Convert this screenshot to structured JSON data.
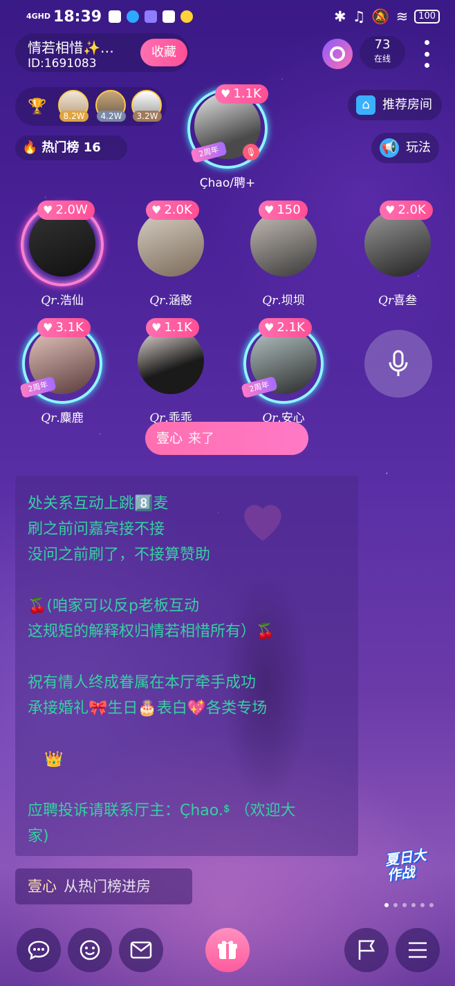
{
  "status_bar": {
    "network": "4GHD",
    "time": "18:39",
    "battery": "100"
  },
  "room": {
    "name": "情若相惜✨…",
    "id": "ID:1691083",
    "favorite_label": "收藏",
    "online_count": "73",
    "online_label": "在线"
  },
  "ranking": {
    "avatars": [
      {
        "value": "8.2W"
      },
      {
        "value": "4.2W"
      },
      {
        "value": "3.2W"
      }
    ],
    "hot_list_label": "热门榜 16"
  },
  "actions": {
    "recommend_label": "推荐房间",
    "play_label": "玩法"
  },
  "host": {
    "name": "Çhao/聘+",
    "hearts": "1.1K",
    "anniversary": "2周年"
  },
  "seats": [
    {
      "prefix": "Qr",
      "name": ".浩仙",
      "hearts": "2.0W"
    },
    {
      "prefix": "Qr",
      "name": ".涵憨",
      "hearts": "2.0K"
    },
    {
      "prefix": "Qr",
      "name": ".坝坝",
      "hearts": "150"
    },
    {
      "prefix": "Qr",
      "name": "喜叁",
      "hearts": "2.0K"
    },
    {
      "prefix": "Qr",
      "name": ".麋鹿",
      "hearts": "3.1K",
      "anniversary": "2周年"
    },
    {
      "prefix": "Qr",
      "name": ".乖乖",
      "hearts": "1.1K"
    },
    {
      "prefix": "Qr",
      "name": ".安心",
      "hearts": "2.1K",
      "anniversary": "2周年"
    }
  ],
  "join_toast": {
    "user": "壹心",
    "action": "来了"
  },
  "announcement": {
    "lines": [
      "处关系互动上跳8️⃣麦",
      "刷之前问嘉宾接不接",
      "没问之前刷了，不接算赞助",
      "",
      "🍒(咱家可以反p老板互动",
      "这规矩的解释权归情若相惜所有）🍒",
      "",
      "祝有情人终成眷属在本厅牵手成功",
      "承接婚礼🎀生日🎂表白💖各类专场",
      "",
      "👑",
      "",
      "应聘投诉请联系厅主：Çhao.ᙚ （欢迎大",
      "家)"
    ]
  },
  "enter_message": {
    "user": "壹心",
    "text": "从热门榜进房"
  },
  "promo": {
    "title": "夏日大作战"
  },
  "colors": {
    "accent_pink": "#ff5b9d",
    "announce_text": "#36d0a1"
  }
}
